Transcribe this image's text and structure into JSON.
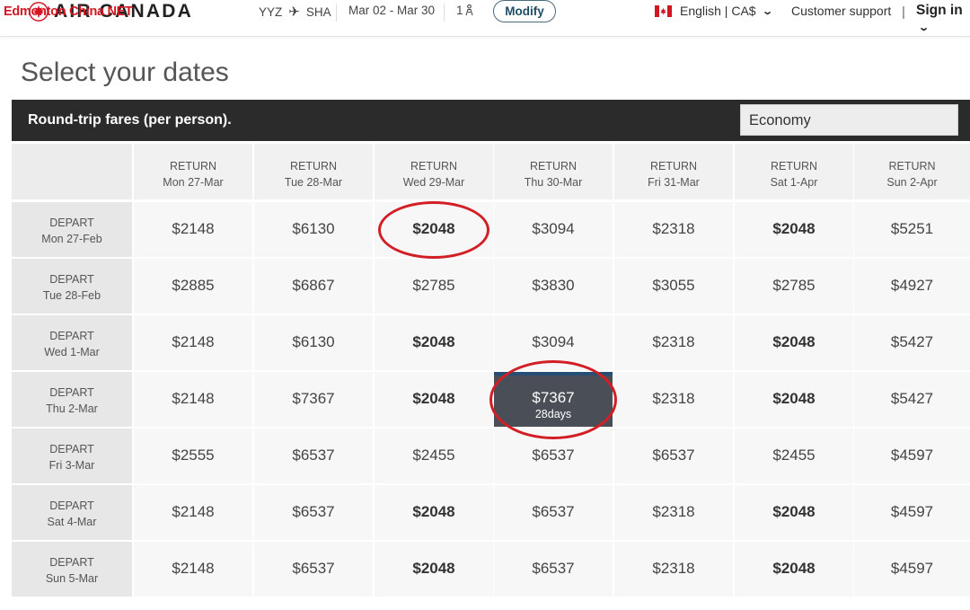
{
  "header": {
    "brand": "AIR CANADA",
    "watermark": "Edmonton China NET",
    "origin": "YYZ",
    "destination": "SHA",
    "dates": "Mar 02 - Mar 30",
    "passengers": "1",
    "modify_label": "Modify",
    "language": "English | CA$",
    "support_label": "Customer support",
    "separator": "|",
    "signin_label": "Sign in",
    "icons": [
      "maple-leaf-icon",
      "plane-icon",
      "person-icon",
      "canada-flag-icon",
      "chevron-down-icon"
    ]
  },
  "page": {
    "title": "Select your dates"
  },
  "fares": {
    "label": "Round-trip fares (per person).",
    "cabin": "Economy",
    "return_label": "RETURN",
    "depart_label": "DEPART",
    "return_dates": [
      "Mon 27-Mar",
      "Tue 28-Mar",
      "Wed 29-Mar",
      "Thu 30-Mar",
      "Fri 31-Mar",
      "Sat 1-Apr",
      "Sun 2-Apr"
    ],
    "rows": [
      {
        "depart": "Mon 27-Feb",
        "prices": [
          "$2148",
          "$6130",
          "$2048",
          "$3094",
          "$2318",
          "$2048",
          "$5251"
        ]
      },
      {
        "depart": "Tue 28-Feb",
        "prices": [
          "$2885",
          "$6867",
          "$2785",
          "$3830",
          "$3055",
          "$2785",
          "$4927"
        ]
      },
      {
        "depart": "Wed 1-Mar",
        "prices": [
          "$2148",
          "$6130",
          "$2048",
          "$3094",
          "$2318",
          "$2048",
          "$5427"
        ]
      },
      {
        "depart": "Thu 2-Mar",
        "prices": [
          "$2148",
          "$7367",
          "$2048",
          "$7367",
          "$2318",
          "$2048",
          "$5427"
        ]
      },
      {
        "depart": "Fri 3-Mar",
        "prices": [
          "$2555",
          "$6537",
          "$2455",
          "$6537",
          "$6537",
          "$2455",
          "$4597"
        ]
      },
      {
        "depart": "Sat 4-Mar",
        "prices": [
          "$2148",
          "$6537",
          "$2048",
          "$6537",
          "$2318",
          "$2048",
          "$4597"
        ]
      },
      {
        "depart": "Sun 5-Mar",
        "prices": [
          "$2148",
          "$6537",
          "$2048",
          "$6537",
          "$2318",
          "$2048",
          "$4597"
        ]
      }
    ],
    "selected": {
      "row": 3,
      "col": 3,
      "duration": "28days"
    },
    "lowest_fare_values": [
      "$2048"
    ],
    "highlight_circles": [
      {
        "row": 0,
        "col": 2
      },
      {
        "row": 3,
        "col": 3
      }
    ],
    "colors": {
      "selected_bg": "#4a4f57",
      "selected_top": "#274e75",
      "circle": "#d21f26",
      "strip_bg": "#2b2b2b"
    }
  }
}
